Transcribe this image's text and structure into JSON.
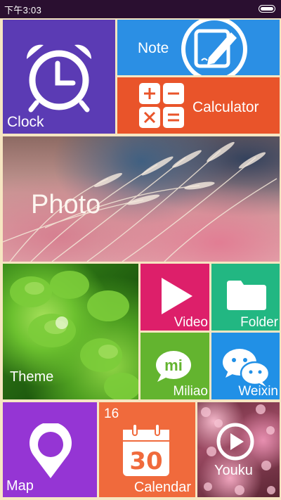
{
  "status_bar": {
    "time": "下午3:03",
    "battery_icon": "battery-full-icon"
  },
  "tiles": {
    "clock": {
      "label": "Clock",
      "color": "#5b3bb4",
      "icon": "alarm-clock-icon"
    },
    "note": {
      "label": "Note",
      "color": "#2b8fe4",
      "icon": "note-pencil-icon"
    },
    "calculator": {
      "label": "Calculator",
      "color": "#e9542a",
      "icon": "calculator-icon"
    },
    "photo": {
      "label": "Photo",
      "icon": "photo-image"
    },
    "theme": {
      "label": "Theme",
      "icon": "theme-image"
    },
    "video": {
      "label": "Video",
      "color": "#dd1f6a",
      "icon": "play-icon"
    },
    "folder": {
      "label": "Folder",
      "color": "#22b782",
      "icon": "folder-icon"
    },
    "miliao": {
      "label": "Miliao",
      "color": "#63b42f",
      "icon": "miliao-bubble-icon",
      "icon_text": "mi"
    },
    "weixin": {
      "label": "Weixin",
      "color": "#2190e6",
      "icon": "wechat-icon"
    },
    "map": {
      "label": "Map",
      "color": "#9535d4",
      "icon": "map-pin-icon"
    },
    "calendar": {
      "label": "Calendar",
      "color": "#f06a3c",
      "icon": "calendar-icon",
      "date_small": "16",
      "date_big": "30"
    },
    "youku": {
      "label": "Youku",
      "icon": "play-circle-icon"
    }
  }
}
